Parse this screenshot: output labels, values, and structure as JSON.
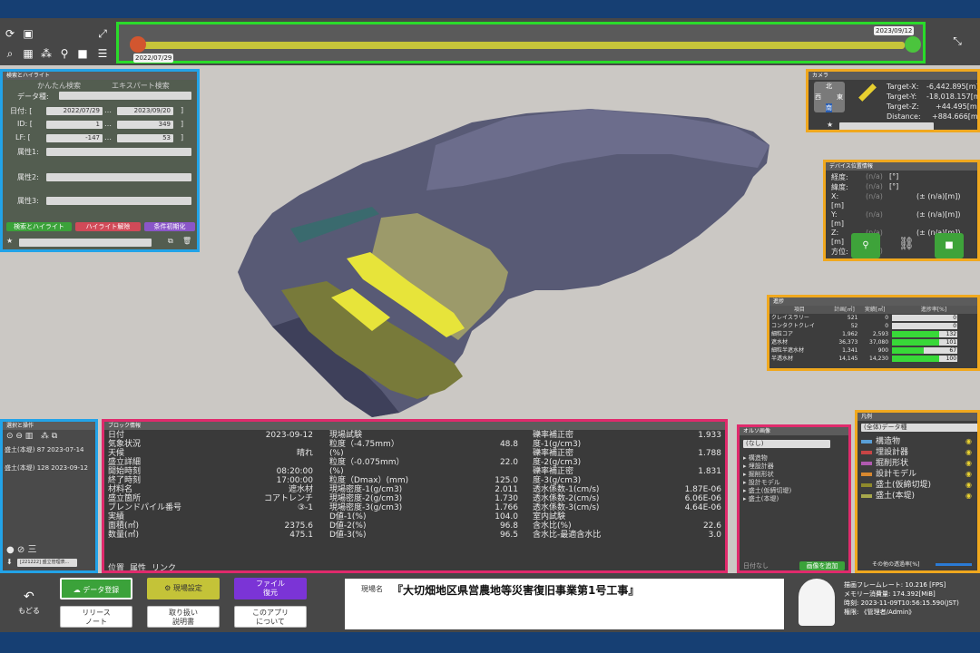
{
  "timeline": {
    "start_date": "2022/07/29",
    "end_date": "2023/09/12"
  },
  "search": {
    "title": "検索とハイライト",
    "tab_simple": "かんたん検索",
    "tab_expert": "エキスパート検索",
    "data_type_label": "データ種:",
    "date_label": "日付: [",
    "date_from": "2022/07/29",
    "date_to": "2023/09/20",
    "id_label": "ID: [",
    "id_from": "1",
    "id_to": "349",
    "lf_label": "LF: [",
    "lf_from": "-147",
    "lf_to": "53",
    "range_sep": "…",
    "close_bracket": "]",
    "attr1": "属性1:",
    "attr2": "属性2:",
    "attr3": "属性3:",
    "btn_highlight": "検索とハイライト",
    "btn_clear": "ハイライト解除",
    "btn_reset": "条件初期化"
  },
  "camera": {
    "title": "カメラ",
    "north": "北",
    "east": "東",
    "west": "西",
    "south": "南",
    "target_x_label": "Target-X:",
    "target_x": "-6,442.895[m]",
    "target_y_label": "Target-Y:",
    "target_y": "-18,018.157[m]",
    "target_z_label": "Target-Z:",
    "target_z": "+44.495[m]",
    "distance_label": "Distance:",
    "distance": "+884.666[m]"
  },
  "device": {
    "title": "デバイス位置情報",
    "lon_label": "経度:",
    "lat_label": "緯度:",
    "x_label": "X:",
    "y_label": "Y:",
    "z_label": "Z:",
    "heading_label": "方位:",
    "na": "(n/a)",
    "deg": "[°]",
    "m": "[m]",
    "pm_m": "(± (n/a)[m])"
  },
  "progress": {
    "title": "進捗",
    "headers": [
      "項目",
      "計画[㎥]",
      "実績[㎥]",
      "進捗率[%]"
    ],
    "rows": [
      {
        "name": "クレイスラリー",
        "plan": "521",
        "actual": "0",
        "rate": "0",
        "fill": 0
      },
      {
        "name": "コンタクトクレイ",
        "plan": "52",
        "actual": "0",
        "rate": "0",
        "fill": 0
      },
      {
        "name": "細粒コア",
        "plan": "1,962",
        "actual": "2,593",
        "rate": "132",
        "fill": 1.0
      },
      {
        "name": "遮水材",
        "plan": "36,373",
        "actual": "37,080",
        "rate": "101",
        "fill": 1.0
      },
      {
        "name": "細粒半遮水材",
        "plan": "1,341",
        "actual": "900",
        "rate": "67",
        "fill": 0.67
      },
      {
        "name": "半透水材",
        "plan": "14,145",
        "actual": "14,230",
        "rate": "100",
        "fill": 1.0
      }
    ]
  },
  "select": {
    "title": "選択と操作",
    "items": [
      {
        "name": "盛土(本堤)",
        "id": "87",
        "date": "2023-07-14"
      },
      {
        "name": "盛土(本堤)",
        "id": "128",
        "date": "2023-09-12"
      }
    ],
    "bottom_label": "[221222] 盛立管理表..."
  },
  "block": {
    "title": "ブロック情報",
    "col1": [
      {
        "k": "日付",
        "v": "2023-09-12"
      },
      {
        "k": "気象状況",
        "v": ""
      },
      {
        "k": "天候",
        "v": "晴れ"
      },
      {
        "k": "盛立詳細",
        "v": ""
      },
      {
        "k": "開始時刻",
        "v": "08:20:00"
      },
      {
        "k": "終了時刻",
        "v": "17:00:00"
      },
      {
        "k": "材料名",
        "v": "遮水材"
      },
      {
        "k": "盛立箇所",
        "v": "コアトレンチ"
      },
      {
        "k": "ブレンドパイル番号",
        "v": "③-1"
      },
      {
        "k": "実績",
        "v": ""
      },
      {
        "k": "面積(㎡)",
        "v": "2375.6"
      },
      {
        "k": "数量(㎥)",
        "v": "475.1"
      }
    ],
    "col2": [
      {
        "k": "現場試験",
        "v": ""
      },
      {
        "k": "粒度（-4.75mm）",
        "v": "48.8"
      },
      {
        "k": "(%)",
        "v": ""
      },
      {
        "k": "粒度（-0.075mm）",
        "v": "22.0"
      },
      {
        "k": "(%)",
        "v": ""
      },
      {
        "k": "粒度（Dmax）(mm)",
        "v": "125.0"
      },
      {
        "k": "現場密度-1(g/cm3)",
        "v": "2.011"
      },
      {
        "k": "現場密度-2(g/cm3)",
        "v": "1.730"
      },
      {
        "k": "現場密度-3(g/cm3)",
        "v": "1.766"
      },
      {
        "k": "D値-1(%)",
        "v": "104.0"
      },
      {
        "k": "D値-2(%)",
        "v": "96.8"
      },
      {
        "k": "D値-3(%)",
        "v": "96.5"
      }
    ],
    "col3": [
      {
        "k": "礫率補正密",
        "v": "1.933"
      },
      {
        "k": "度-1(g/cm3)",
        "v": ""
      },
      {
        "k": "礫率補正密",
        "v": "1.788"
      },
      {
        "k": "度-2(g/cm3)",
        "v": ""
      },
      {
        "k": "礫率補正密",
        "v": "1.831"
      },
      {
        "k": "度-3(g/cm3)",
        "v": ""
      },
      {
        "k": "透水係数-1(cm/s)",
        "v": "1.87E-06"
      },
      {
        "k": "透水係数-2(cm/s)",
        "v": "6.06E-06"
      },
      {
        "k": "透水係数-3(cm/s)",
        "v": "4.64E-06"
      },
      {
        "k": "室内試験",
        "v": ""
      },
      {
        "k": "含水比(%)",
        "v": "22.6"
      },
      {
        "k": "含水比-最適含水比",
        "v": "3.0"
      }
    ],
    "tabs": [
      "位置",
      "属性",
      "リンク"
    ]
  },
  "ortho": {
    "title": "オルソ画像",
    "selected": "(なし)",
    "items": [
      "構造物",
      "埋設計器",
      "掘削形状",
      "設計モデル",
      "盛土(仮締切堤)",
      "盛土(本堤)"
    ],
    "no_date": "日付なし",
    "add_button": "画像を追加"
  },
  "legend": {
    "title": "凡例",
    "selected": "(全体)データ種",
    "items": [
      {
        "label": "構造物",
        "color": "#5aa0d8"
      },
      {
        "label": "埋設計器",
        "color": "#c84545"
      },
      {
        "label": "掘削形状",
        "color": "#b05ab0"
      },
      {
        "label": "設計モデル",
        "color": "#d8882f"
      },
      {
        "label": "盛土(仮締切堤)",
        "color": "#8f8a2c"
      },
      {
        "label": "盛土(本堤)",
        "color": "#a7a84c"
      }
    ],
    "other_transparency": "その他の透過率[%]"
  },
  "bottom": {
    "back": "もどる",
    "btn_data": "データ登録",
    "btn_site": "現場設定",
    "btn_file": "ファイル\n復元",
    "btn_release": "リリース\nノート",
    "btn_manual": "取り扱い\n説明書",
    "btn_about": "このアプリ\nについて",
    "site_label": "現場名",
    "site_name": "『大切畑地区県営農地等災害復旧事業第1号工事』",
    "stats_fps": "描画フレームレート: 10.216 [FPS]",
    "stats_mem": "メモリー消費量: 174.392[MiB]",
    "stats_time": "時刻: 2023-11-09T10:56:15.590(JST)",
    "stats_role": "権限: 《管理者/Admin》"
  }
}
